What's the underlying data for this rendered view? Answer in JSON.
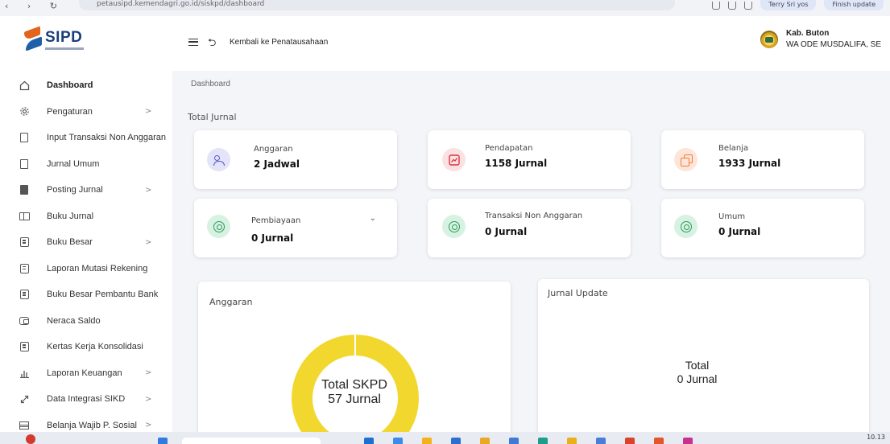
{
  "browser": {
    "url": "petausipd.kemendagri.go.id/siskpd/dashboard",
    "pill_1": "Terry Sri yos",
    "pill_2": "Finish update"
  },
  "app": {
    "logo_text": "SIPD"
  },
  "sidebar": {
    "items": [
      {
        "label": "Dashboard",
        "icon": "home-icon",
        "active": true,
        "chevron": ""
      },
      {
        "label": "Pengaturan",
        "icon": "gear-icon",
        "chevron": ">"
      },
      {
        "label": "Input Transaksi Non Anggaran",
        "icon": "document-icon",
        "chevron": ""
      },
      {
        "label": "Jurnal Umum",
        "icon": "document-icon",
        "chevron": ""
      },
      {
        "label": "Posting Jurnal",
        "icon": "document-filled-icon",
        "chevron": ">"
      },
      {
        "label": "Buku Jurnal",
        "icon": "book-icon",
        "chevron": ""
      },
      {
        "label": "Buku Besar",
        "icon": "ledger-icon",
        "chevron": ">"
      },
      {
        "label": "Laporan Mutasi Rekening",
        "icon": "ledger-icon",
        "chevron": ""
      },
      {
        "label": "Buku Besar Pembantu Bank",
        "icon": "ledger-icon",
        "chevron": ""
      },
      {
        "label": "Neraca Saldo",
        "icon": "wallet-icon",
        "chevron": ""
      },
      {
        "label": "Kertas Kerja Konsolidasi",
        "icon": "ledger-icon",
        "chevron": ""
      },
      {
        "label": "Laporan Keuangan",
        "icon": "bar-chart-icon",
        "chevron": ">"
      },
      {
        "label": "Data Integrasi SIKD",
        "icon": "link-icon",
        "chevron": ">"
      },
      {
        "label": "Belanja Wajib P. Sosial",
        "icon": "grid-icon",
        "chevron": ">"
      }
    ]
  },
  "header": {
    "back_label": "Kembali ke Penatausahaan",
    "region": "Kab. Buton",
    "user_name": "WA ODE MUSDALIFA, SE"
  },
  "main": {
    "breadcrumb": "Dashboard",
    "section_title": "Total Jurnal",
    "cards": [
      {
        "label": "Anggaran",
        "value": "2 Jadwal",
        "icon": "users-icon",
        "color": "#5a58c8"
      },
      {
        "label": "Pendapatan",
        "value": "1158 Jurnal",
        "icon": "trend-chart-icon",
        "color": "#d9343f"
      },
      {
        "label": "Belanja",
        "value": "1933 Jurnal",
        "icon": "copy-icon",
        "color": "#f07d3a"
      },
      {
        "label": "Pembiayaan",
        "value": "0 Jurnal",
        "icon": "support-icon",
        "color": "#2f9b5a"
      },
      {
        "label": "Transaksi Non Anggaran",
        "value": "0 Jurnal",
        "icon": "support-icon",
        "color": "#2f9b5a"
      },
      {
        "label": "Umum",
        "value": "0 Jurnal",
        "icon": "support-icon",
        "color": "#2f9b5a"
      }
    ],
    "anggaran_panel": {
      "title": "Anggaran",
      "center_line1": "Total SKPD",
      "center_line2": "57 Jurnal",
      "donut_color": "#f2d72e"
    },
    "jurnal_update_panel": {
      "title": "Jurnal Update",
      "center_line1": "Total",
      "center_line2": "0 Jurnal"
    }
  },
  "taskbar": {
    "time": "10.13"
  }
}
